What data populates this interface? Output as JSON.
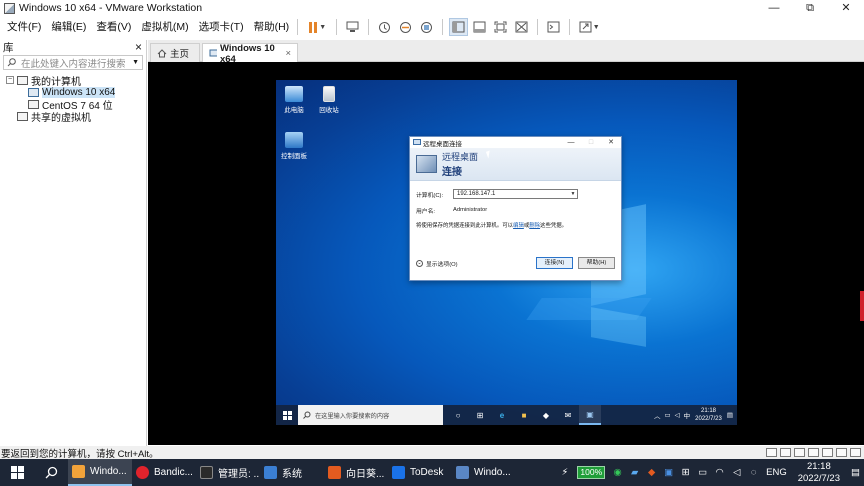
{
  "window": {
    "title": "Windows 10 x64 - VMware Workstation",
    "controls": [
      "—",
      "⧉",
      "✕"
    ]
  },
  "menu": [
    "文件(F)",
    "编辑(E)",
    "查看(V)",
    "虚拟机(M)",
    "选项卡(T)",
    "帮助(H)"
  ],
  "library": {
    "title": "库",
    "close": "×",
    "search_placeholder": "在此处键入内容进行搜索",
    "tree": [
      {
        "label": "我的计算机",
        "level": 0,
        "expander": "−"
      },
      {
        "label": "Windows 10 x64",
        "level": 1,
        "selected": true
      },
      {
        "label": "CentOS 7 64 位",
        "level": 1
      },
      {
        "label": "共享的虚拟机",
        "level": 0
      }
    ]
  },
  "tabs": [
    {
      "label": "主页",
      "icon": "home-icon"
    },
    {
      "label": "Windows 10 x64",
      "icon": "vm-icon",
      "active": true,
      "close": "×"
    }
  ],
  "guest": {
    "desktop_icons": [
      {
        "label": "此电脑",
        "icon": "this-pc-icon"
      },
      {
        "label": "回收站",
        "icon": "recycle-bin-icon"
      },
      {
        "label": "控制面板",
        "icon": "control-panel-icon"
      }
    ],
    "rdp_dialog": {
      "title": "远程桌面连接",
      "win_controls": [
        "—",
        "□",
        "✕"
      ],
      "banner_line1": "远程桌面",
      "banner_line2": "连接",
      "computer_label": "计算机(C):",
      "computer_value": "192.168.147.1",
      "user_label": "用户名:",
      "user_value": "Administrator",
      "note_prefix": "将使用保存的凭据连接到此计算机。可以",
      "note_edit": "编辑",
      "note_or": "或",
      "note_delete": "删除",
      "note_suffix": "这些凭据。",
      "options_label": "显示选项(O)",
      "connect_button": "连接(N)",
      "help_button": "帮助(H)"
    },
    "taskbar": {
      "search_placeholder": "在这里输入你要搜索的内容",
      "tray_lang": "中",
      "time": "21:18",
      "date": "2022/7/23"
    }
  },
  "statusbar": {
    "message": "要返回到您的计算机，请按 Ctrl+Alt。"
  },
  "host_taskbar": {
    "apps": [
      {
        "label": "Windo...",
        "color": "#f2a33a",
        "active": true
      },
      {
        "label": "Bandic...",
        "color": "#e0232c"
      },
      {
        "label": "管理员: ...",
        "color": "#2b2b2b"
      },
      {
        "label": "系统",
        "color": "#3b7fd3"
      },
      {
        "label": "向日葵...",
        "color": "#e35b20"
      },
      {
        "label": "ToDesk",
        "color": "#1a72e8"
      },
      {
        "label": "Windo...",
        "color": "#5a87c5"
      }
    ],
    "battery": "100%",
    "lang": "ENG",
    "time": "21:18",
    "date": "2022/7/23"
  }
}
